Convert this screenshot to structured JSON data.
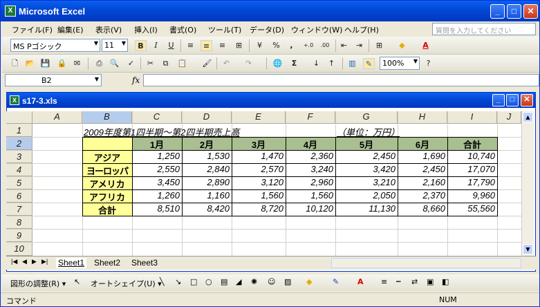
{
  "app": {
    "title": "Microsoft Excel",
    "icon_name": "excel-icon"
  },
  "window_buttons": {
    "minimize": "_",
    "maximize": "□",
    "close": "✕"
  },
  "menu": [
    "ファイル(F)",
    "編集(E)",
    "表示(V)",
    "挿入(I)",
    "書式(O)",
    "ツール(T)",
    "データ(D)",
    "ウィンドウ(W)",
    "ヘルプ(H)"
  ],
  "help_box": {
    "placeholder": "質問を入力してください"
  },
  "format_toolbar": {
    "font": "MS Pゴシック",
    "size": "11",
    "bold": "B",
    "italic": "I",
    "underline": "U",
    "percent": "%",
    "comma": ",",
    "inc_decimal": "+.0",
    "dec_decimal": ".00"
  },
  "standard_toolbar": {
    "zoom": "100%",
    "sigma": "Σ"
  },
  "formula_bar": {
    "name_box": "B2",
    "fx": "fx",
    "content": ""
  },
  "workbook": {
    "title": "s17-3.xls"
  },
  "columns": [
    "A",
    "B",
    "C",
    "D",
    "E",
    "F",
    "G",
    "H",
    "I"
  ],
  "extra_column": "J",
  "rows": [
    "1",
    "2",
    "3",
    "4",
    "5",
    "6",
    "7",
    "8",
    "9",
    "10"
  ],
  "sheet": {
    "title": "2009年度第1四半期～第2四半期売上高",
    "unit": "（単位：万円）",
    "months": [
      "1月",
      "2月",
      "3月",
      "4月",
      "5月",
      "6月",
      "合計"
    ],
    "regions": [
      "アジア",
      "ヨーロッパ",
      "アメリカ",
      "アフリカ",
      "合計"
    ],
    "values": [
      [
        "1,250",
        "1,530",
        "1,470",
        "2,360",
        "2,450",
        "1,690",
        "10,740"
      ],
      [
        "2,550",
        "2,840",
        "2,570",
        "3,240",
        "3,420",
        "2,450",
        "17,070"
      ],
      [
        "3,450",
        "2,890",
        "3,120",
        "2,960",
        "3,210",
        "2,160",
        "17,790"
      ],
      [
        "1,260",
        "1,160",
        "1,560",
        "1,560",
        "2,050",
        "2,370",
        "9,960"
      ],
      [
        "8,510",
        "8,420",
        "8,720",
        "10,120",
        "11,130",
        "8,660",
        "55,560"
      ]
    ]
  },
  "colors": {
    "month_header_bg": "#A9BF91",
    "region_bg": "#FFFF99",
    "titlebar": "#0247D6"
  },
  "sheet_tabs": [
    "Sheet1",
    "Sheet2",
    "Sheet3"
  ],
  "draw_toolbar": {
    "adjust": "図形の調整(R) ▾",
    "autoshape": "オートシェイプ(U) ▾"
  },
  "status": {
    "mode": "コマンド",
    "num": "NUM"
  }
}
